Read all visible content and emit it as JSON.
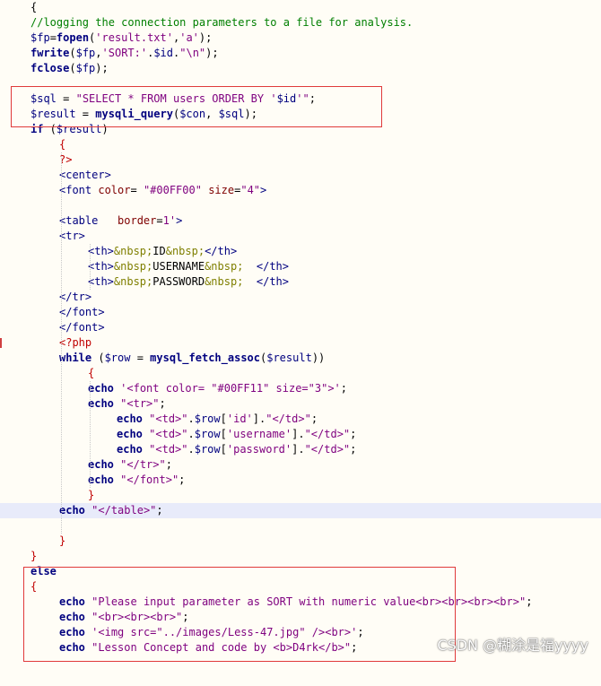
{
  "editor": {
    "lines": [
      "{",
      "//logging the connection parameters to a file for analysis.",
      "$fp=fopen('result.txt','a');",
      "fwrite($fp,'SORT:'.$id.\"\\n\");",
      "fclose($fp);",
      "",
      "$sql = \"SELECT * FROM users ORDER BY '$id'\";",
      "$result = mysqli_query($con, $sql);",
      "if ($result)",
      "{",
      "?>",
      "<center>",
      "<font color= \"#00FF00\" size=\"4\">",
      "",
      "<table   border=1'>",
      "<tr>",
      "<th>&nbsp;ID&nbsp;</th>",
      "<th>&nbsp;USERNAME&nbsp;  </th>",
      "<th>&nbsp;PASSWORD&nbsp;  </th>",
      "</tr>",
      "</font>",
      "</font>",
      "<?php",
      "while ($row = mysql_fetch_assoc($result))",
      "{",
      "echo '<font color= \"#00FF11\" size=\"3\">';",
      "echo \"<tr>\";",
      "echo \"<td>\".$row['id'].\"</td>\";",
      "echo \"<td>\".$row['username'].\"</td>\";",
      "echo \"<td>\".$row['password'].\"</td>\";",
      "echo \"</tr>\";",
      "echo \"</font>\";",
      "}",
      "echo \"</table>\";",
      "",
      "}",
      "}",
      "else",
      "{",
      "echo \"Please input parameter as SORT with numeric value<br><br><br><br>\";",
      "echo \"<br><br><br>\";",
      "echo '<img src=\"../images/Less-47.jpg\" /><br>';",
      "echo \"Lesson Concept and code by <b>D4rk</b>\";"
    ]
  },
  "watermark": "CSDN @糊涂是福yyyy",
  "colors": {
    "highlight_box": "#e03a3a",
    "line_highlight": "#e8ebfa",
    "background": "#fffdf6"
  }
}
